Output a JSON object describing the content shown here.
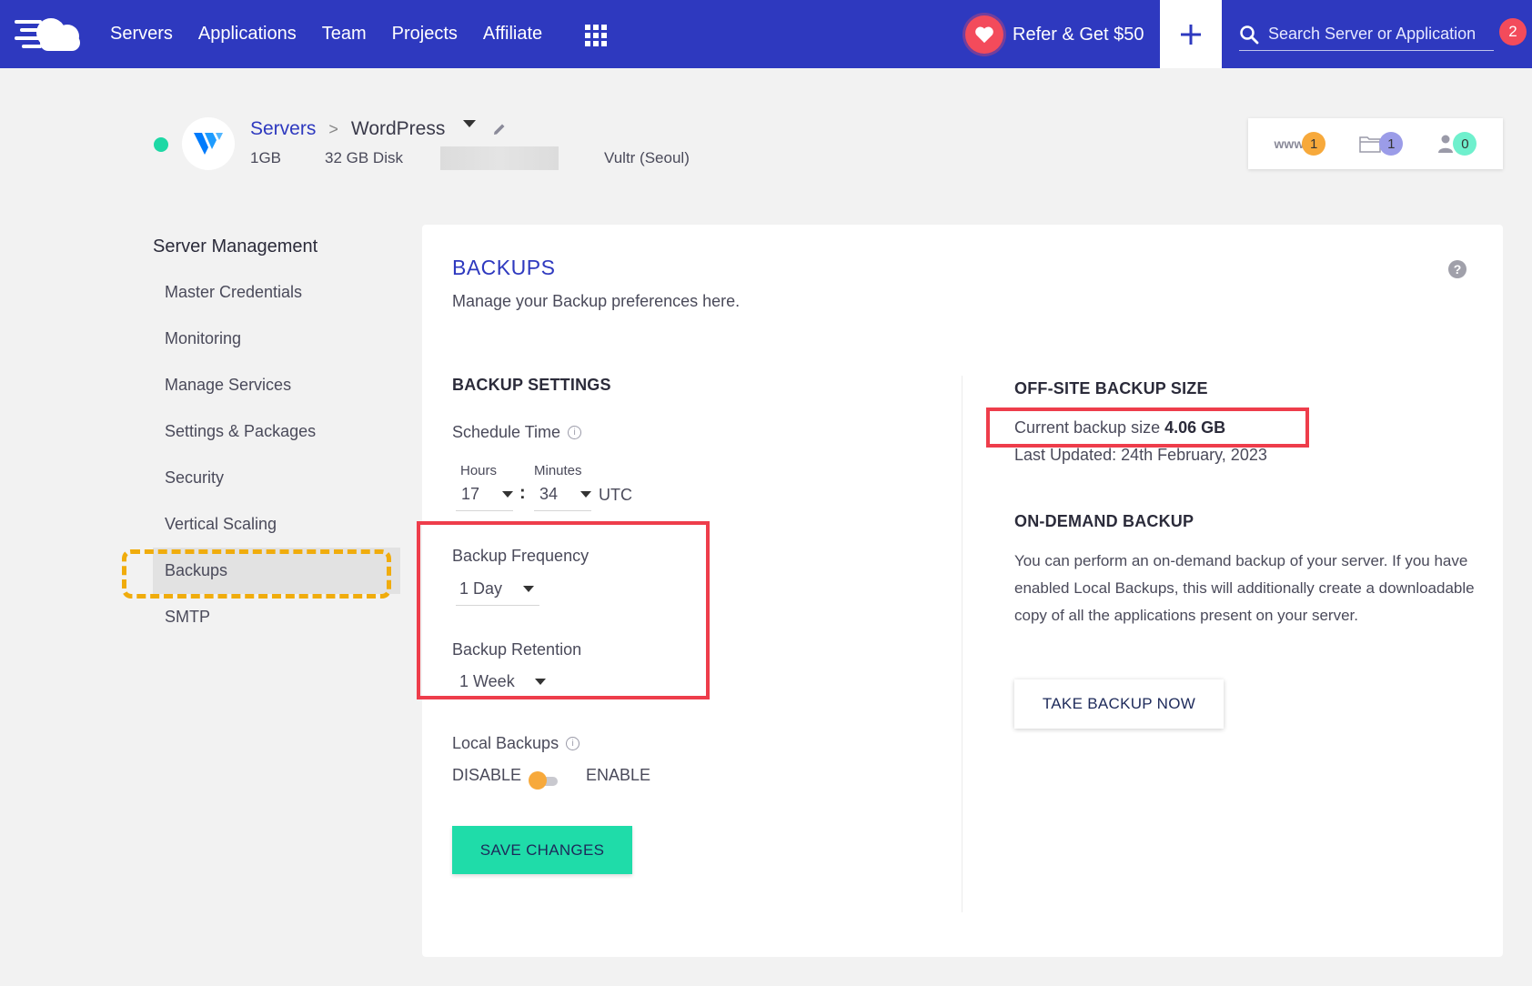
{
  "nav": {
    "items": [
      "Servers",
      "Applications",
      "Team",
      "Projects",
      "Affiliate"
    ],
    "refer_label": "Refer & Get $50",
    "search_placeholder": "Search Server or Application",
    "notification_count": "2"
  },
  "server": {
    "breadcrumb_root": "Servers",
    "breadcrumb_sep": ">",
    "name": "WordPress",
    "ram": "1GB",
    "disk": "32 GB Disk",
    "location": "Vultr (Seoul)",
    "status_color": "#1ed8a5",
    "counters": [
      {
        "icon": "www-icon",
        "label": "www",
        "count": "1",
        "color": "#f7a93b"
      },
      {
        "icon": "folder-icon",
        "label": "",
        "count": "1",
        "color": "#9b9ce8"
      },
      {
        "icon": "user-icon",
        "label": "",
        "count": "0",
        "color": "#6ff0cd"
      }
    ]
  },
  "sidebar": {
    "title": "Server Management",
    "items": [
      "Master Credentials",
      "Monitoring",
      "Manage Services",
      "Settings & Packages",
      "Security",
      "Vertical Scaling",
      "Backups",
      "SMTP"
    ],
    "active": "Backups"
  },
  "backups": {
    "title": "BACKUPS",
    "subtitle": "Manage your Backup preferences here.",
    "settings_heading": "BACKUP SETTINGS",
    "schedule_label": "Schedule Time",
    "hours_label": "Hours",
    "minutes_label": "Minutes",
    "hours_value": "17",
    "minutes_value": "34",
    "colon": ":",
    "timezone": "UTC",
    "frequency_label": "Backup Frequency",
    "frequency_value": "1 Day",
    "retention_label": "Backup Retention",
    "retention_value": "1 Week",
    "local_label": "Local Backups",
    "disable_label": "DISABLE",
    "enable_label": "ENABLE",
    "local_enabled": false,
    "save_label": "SAVE CHANGES",
    "offsite_heading": "OFF-SITE BACKUP SIZE",
    "current_size_prefix": "Current backup size",
    "current_size_value": "4.06 GB",
    "last_updated": "Last Updated: 24th February, 2023",
    "ondemand_heading": "ON-DEMAND BACKUP",
    "ondemand_text": "You can perform an on-demand backup of your server. If you have enabled Local Backups, this will additionally create a downloadable copy of all the applications present on your server.",
    "take_backup_label": "TAKE BACKUP NOW"
  },
  "colors": {
    "brand": "#2e39bf",
    "accent_green": "#1fdca9",
    "highlight_red": "#ee3d4b",
    "highlight_amber": "#f0ac0c"
  }
}
